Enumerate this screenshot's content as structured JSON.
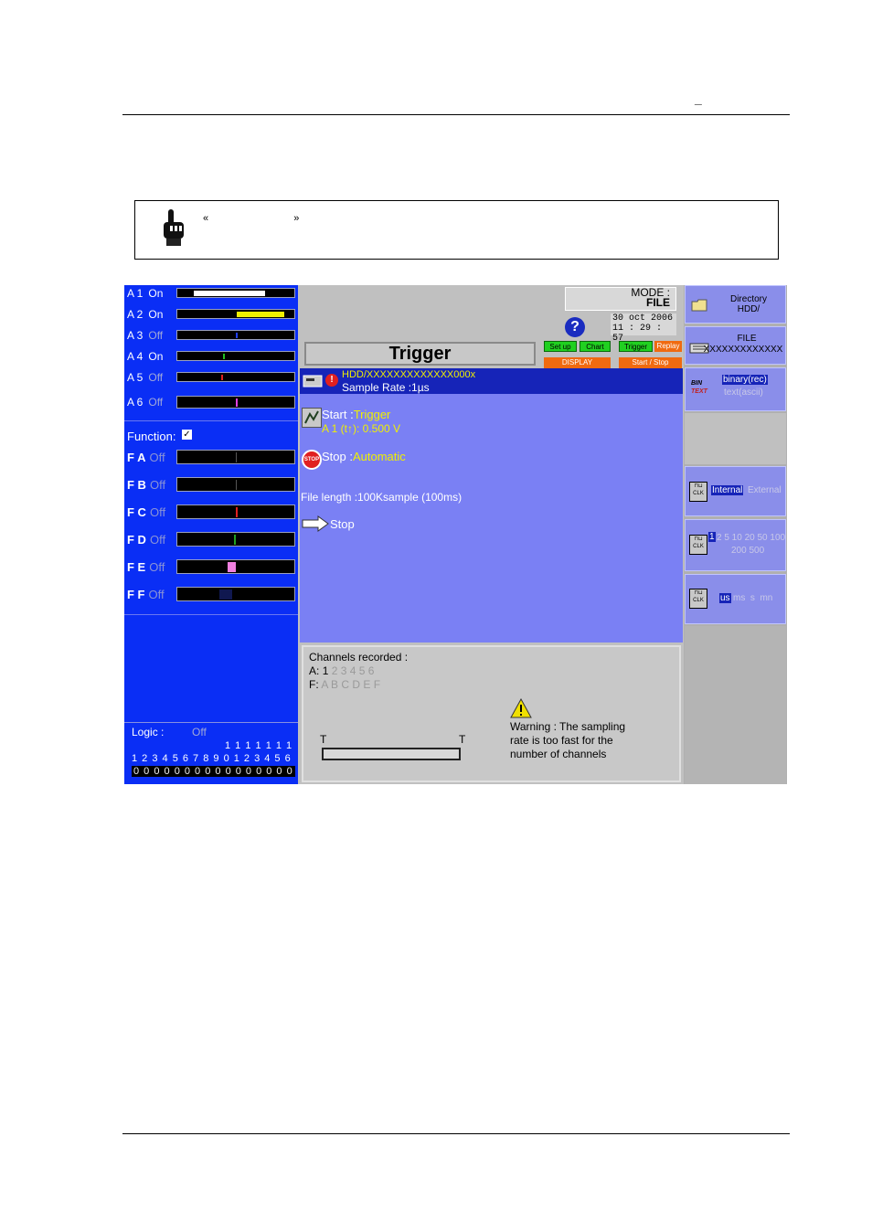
{
  "doc": {
    "header_mark": "_",
    "note": {
      "open_quote": "«",
      "close_quote": "»"
    }
  },
  "channels": [
    {
      "label": "A 1",
      "state": "On"
    },
    {
      "label": "A 2",
      "state": "On"
    },
    {
      "label": "A 3",
      "state": "Off"
    },
    {
      "label": "A 4",
      "state": "On"
    },
    {
      "label": "A 5",
      "state": "Off"
    },
    {
      "label": "A 6",
      "state": "Off"
    }
  ],
  "function_label": "Function:",
  "functions": [
    {
      "label": "F A",
      "state": "Off"
    },
    {
      "label": "F B",
      "state": "Off"
    },
    {
      "label": "F C",
      "state": "Off"
    },
    {
      "label": "F D",
      "state": "Off"
    },
    {
      "label": "F E",
      "state": "Off"
    },
    {
      "label": "F F",
      "state": "Off"
    }
  ],
  "logic": {
    "label": "Logic :",
    "state": "Off",
    "row_tens": "1 1 1 1 1 1 1",
    "row_units": "1 2 3 4 5 6 7 8 9 0 1 2 3 4 5 6",
    "row_values": "0 0 0 0 0 0 0 0 0 0 0 0 0 0 0 0"
  },
  "top": {
    "mode_label": "MODE :",
    "mode_value": "FILE",
    "date": "30 oct 2006",
    "time": "11 : 29 : 57",
    "help": "?"
  },
  "title": "Trigger",
  "buttons": {
    "setup": "Set up",
    "chart": "Chart",
    "trigger": "Trigger",
    "replay": "Replay",
    "display": "DISPLAY",
    "startstop": "Start / Stop"
  },
  "file_header": {
    "path": "HDD/XXXXXXXXXXXXX000x",
    "rate": "Sample Rate :1µs"
  },
  "start": {
    "label": "Start :",
    "value": "Trigger",
    "condition": "A 1 (t↑):  0.500 V"
  },
  "stop": {
    "label": "Stop  :",
    "value": "Automatic",
    "icon_text": "STOP"
  },
  "file_length": "File length :100Ksample  (100ms)",
  "stop_action": "Stop",
  "recorded": {
    "title": "Channels recorded :",
    "a_prefix": "A:",
    "a_on": "1",
    "a_off": "2 3 4 5 6",
    "f_prefix": "F:",
    "f_off": "A B C D E F"
  },
  "timeline": {
    "t_left": "T",
    "t_right": "T"
  },
  "warning": {
    "line1": "Warning : The sampling",
    "line2": "rate is too fast for the",
    "line3": "number of channels"
  },
  "right": {
    "directory": "Directory",
    "directory_path": "HDD/",
    "file": "FILE",
    "file_name": "XXXXXXXXXXXXX",
    "bin": "BIN",
    "text": "TEXT",
    "fmt_selected": "binary(rec)",
    "fmt_other": "text(ascii)",
    "clk_selected": "Internal",
    "clk_other": "External",
    "rate_selected": "1",
    "rate_row1": "2 5 10 20 50 100",
    "rate_row2": "200 500",
    "unit_selected": "us",
    "unit_other": "ms  s  mn",
    "clk_icon": "CLK"
  },
  "colors": {
    "panel_blue": "#0a2ef5",
    "area_blue": "#7a80f4",
    "header_blue": "#1624b8"
  }
}
